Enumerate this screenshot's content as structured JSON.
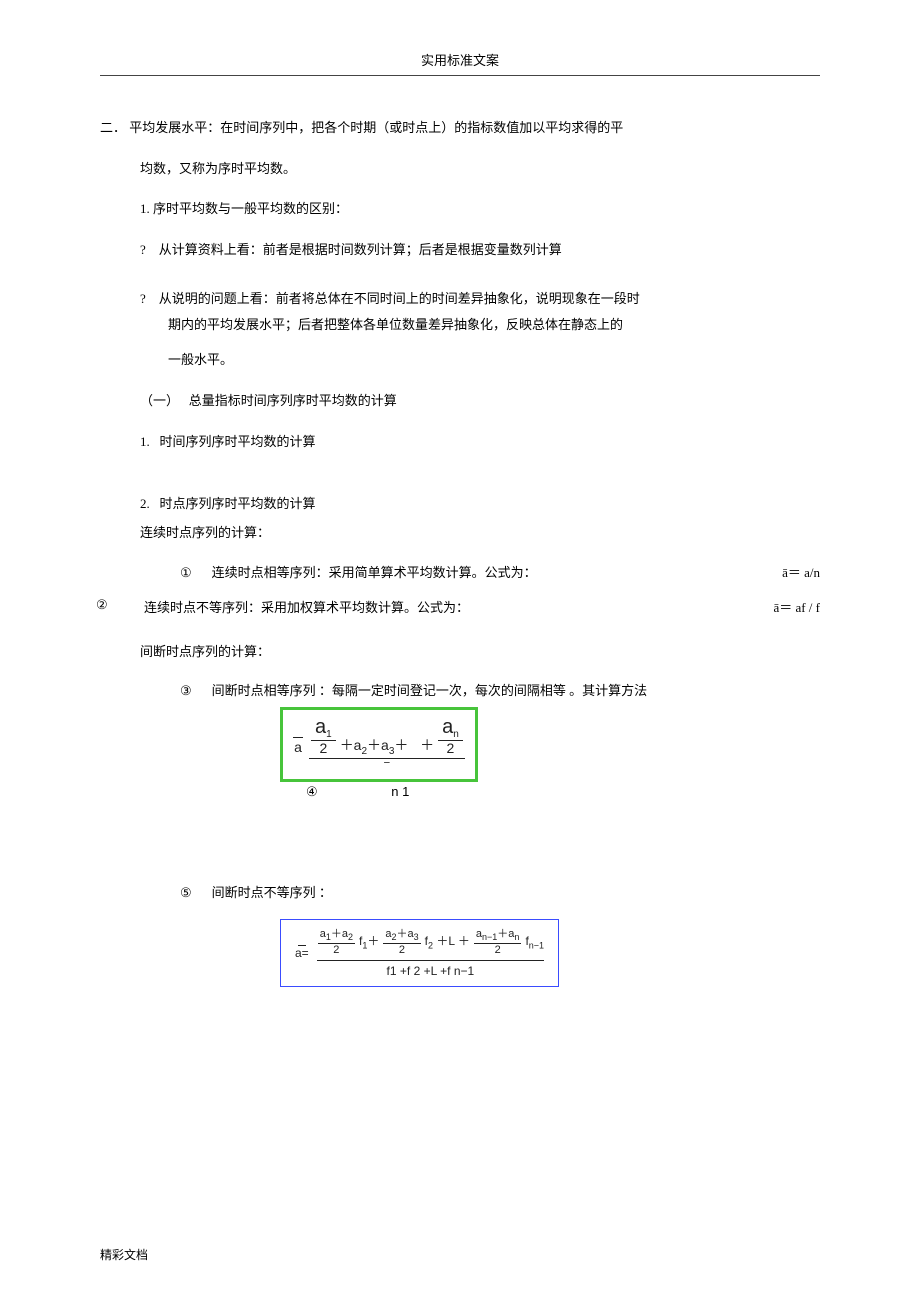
{
  "header": {
    "title": "实用标准文案"
  },
  "sec2": {
    "label": "二．",
    "heading_a": "平均发展水平：在时间序列中，把各个时期（或时点上）的指标数值加以平均求得的平",
    "heading_b": "均数，又称为序时平均数。",
    "point1_label": "1.",
    "point1_text": "序时平均数与一般平均数的区别：",
    "q1_mark": "?",
    "q1_text": "从计算资料上看：前者是根据时间数列计算；后者是根据变量数列计算",
    "q2_mark": "?",
    "q2_text_a": "从说明的问题上看：前者将总体在不同时间上的时间差异抽象化，说明现象在一段时",
    "q2_text_b": "期内的平均发展水平；后者把整体各单位数量差异抽象化，反映总体在静态上的",
    "q2_text_c": "一般水平。",
    "sub1_label": "（一）",
    "sub1_text": "总量指标时间序列序时平均数的计算",
    "p1_label": "1.",
    "p1_text": "时间序列序时平均数的计算",
    "p2_label": "2.",
    "p2_text": "时点序列序时平均数的计算",
    "p2_sub": "连续时点序列的计算：",
    "c1_label": "①",
    "c1_text": "连续时点相等序列：采用简单算术平均数计算。公式为：",
    "c1_formula": "ā＝  a/n",
    "c2_label": "②",
    "c2_text": "连续时点不等序列：采用加权算术平均数计算。公式为：",
    "c2_formula": "ā＝  af /     f",
    "p3_sub": "间断时点序列的计算：",
    "c3_label": "③",
    "c3_text": "间断时点相等序列    ：每隔一定时间登记一次，每次的间隔相等    。其计算方法",
    "c4_label": "④",
    "c4_den": "n  1",
    "c5_label": "⑤",
    "c5_text": "间断时点不等序列    ："
  },
  "formula_green": {
    "lhs_bar": "‾",
    "lhs": "a",
    "eq": "＝",
    "terms": [
      "a",
      "1",
      "2",
      "＋a",
      "2",
      "＋a",
      "3",
      "＋    ＋",
      "a",
      "n",
      "2"
    ],
    "below": "④            n  1"
  },
  "formula_blue": {
    "lhs": "a=",
    "bar": "‾",
    "row": "a1＋a2 f 1＋ a2＋a3 f2 ＋L ＋ an−1＋an f n−1",
    "numer_frac_d": "2",
    "den": "f1 +f 2 +L +f n−1"
  },
  "footer": {
    "text": "精彩文档"
  }
}
